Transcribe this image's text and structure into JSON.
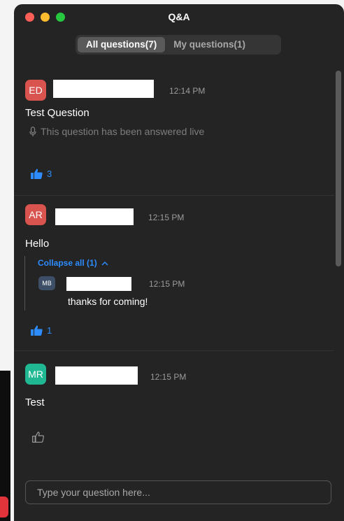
{
  "window": {
    "title": "Q&A",
    "tabs": [
      {
        "label": "All questions(7)",
        "active": true
      },
      {
        "label": "My questions(1)",
        "active": false
      }
    ]
  },
  "questions": [
    {
      "avatar": {
        "initials": "ED",
        "color": "#d9534f"
      },
      "time": "12:14 PM",
      "text": "Test Question",
      "status": "This question has been answered live",
      "status_icon": "microphone-icon",
      "likes": "3",
      "liked": true
    },
    {
      "avatar": {
        "initials": "AR",
        "color": "#d9534f"
      },
      "time": "12:15 PM",
      "text": "Hello",
      "collapse_label": "Collapse all (1)",
      "collapse_icon": "chevron-up-icon",
      "reply": {
        "avatar": {
          "initials": "MB",
          "color": "#3d4f66"
        },
        "time": "12:15 PM",
        "text": "thanks for coming!"
      },
      "likes": "1",
      "liked": true
    },
    {
      "avatar": {
        "initials": "MR",
        "color": "#1fb892"
      },
      "time": "12:15 PM",
      "text": "Test",
      "likes": "",
      "liked": false
    }
  ],
  "input": {
    "value": "",
    "placeholder": "Type your question here..."
  },
  "colors": {
    "accent": "#2d8cff",
    "background": "#242424"
  }
}
